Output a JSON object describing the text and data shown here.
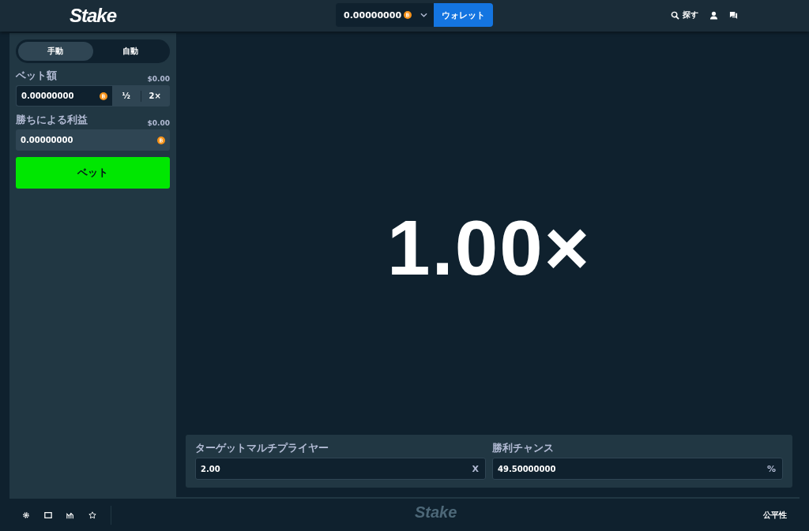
{
  "header": {
    "logo": "Stake",
    "balance": "0.00000000",
    "wallet_button": "ウォレット",
    "search": "探す"
  },
  "sidebar": {
    "tabs": [
      {
        "label": "手動",
        "selected": true
      },
      {
        "label": "自動",
        "selected": false
      }
    ],
    "bet_amount": {
      "label": "ベット額",
      "usd": "$0.00",
      "value": "0.00000000",
      "half": "½",
      "double": "2×"
    },
    "profit": {
      "label": "勝ちによる利益",
      "usd": "$0.00",
      "value": "0.00000000"
    },
    "bet_button": "ベット"
  },
  "game": {
    "multiplier": "1.00×"
  },
  "controls": [
    {
      "label": "ターゲットマルチプライヤー",
      "value": "2.00",
      "suffix": "X"
    },
    {
      "label": "勝利チャンス",
      "value": "49.50000000",
      "suffix": "%"
    }
  ],
  "footer": {
    "logo": "Stake",
    "fairness": "公平性"
  }
}
